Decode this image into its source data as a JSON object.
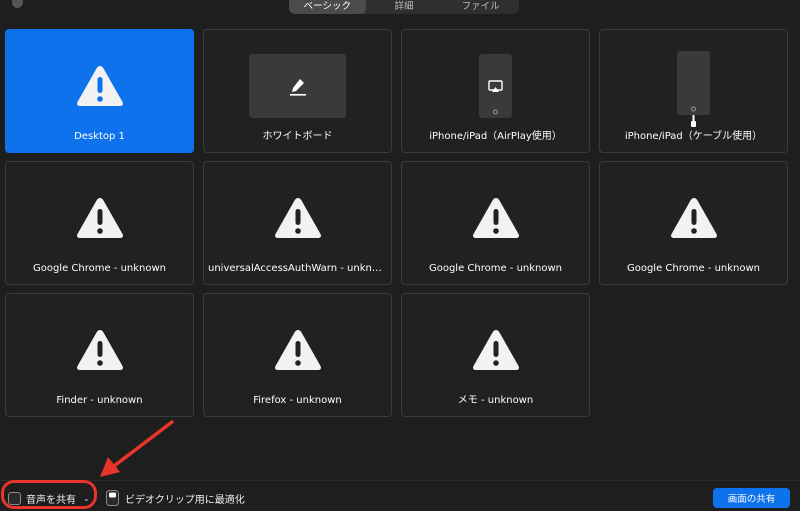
{
  "tabs": [
    {
      "label": "ベーシック",
      "active": true
    },
    {
      "label": "詳細",
      "active": false
    },
    {
      "label": "ファイル",
      "active": false
    }
  ],
  "sources": [
    {
      "label": "Desktop 1",
      "icon": "warning-icon",
      "selected": true
    },
    {
      "label": "ホワイトボード",
      "icon": "whiteboard-pen-icon",
      "selected": false
    },
    {
      "label": "iPhone/iPad（AirPlay使用）",
      "icon": "iphone-airplay-icon",
      "selected": false
    },
    {
      "label": "iPhone/iPad（ケーブル使用）",
      "icon": "iphone-cable-icon",
      "selected": false
    },
    {
      "label": "Google Chrome - unknown",
      "icon": "warning-icon",
      "selected": false
    },
    {
      "label": "universalAccessAuthWarn - unknown",
      "icon": "warning-icon",
      "selected": false
    },
    {
      "label": "Google Chrome - unknown",
      "icon": "warning-icon",
      "selected": false
    },
    {
      "label": "Google Chrome - unknown",
      "icon": "warning-icon",
      "selected": false
    },
    {
      "label": "Finder - unknown",
      "icon": "warning-icon",
      "selected": false
    },
    {
      "label": "Firefox - unknown",
      "icon": "warning-icon",
      "selected": false
    },
    {
      "label": "メモ - unknown",
      "icon": "warning-icon",
      "selected": false
    }
  ],
  "bottom": {
    "share_audio_label": "音声を共有",
    "share_audio_checked": false,
    "optimize_video_label": "ビデオクリップ用に最適化",
    "optimize_video_checked": false,
    "share_button_label": "画面の共有"
  },
  "colors": {
    "accent": "#0e72ed",
    "annotation": "#e8352b",
    "background": "#1e1e1e"
  }
}
